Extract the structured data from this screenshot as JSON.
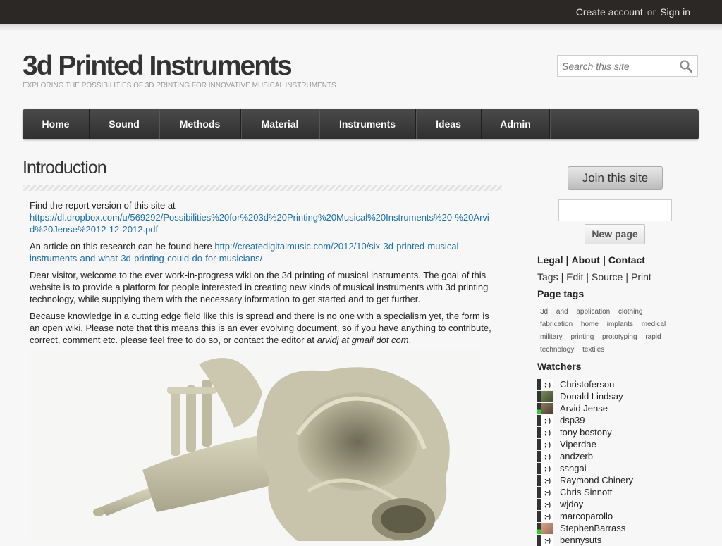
{
  "topbar": {
    "create_account": "Create account",
    "or": "or",
    "sign_in": "Sign in"
  },
  "header": {
    "title": "3d Printed Instruments",
    "subtitle": "Exploring the possibilities of 3D printing for innovative musical instruments"
  },
  "search": {
    "placeholder": "Search this site",
    "icon": "search-icon"
  },
  "nav": {
    "items": [
      "Home",
      "Sound",
      "Methods",
      "Material",
      "Instruments",
      "Ideas",
      "Admin"
    ]
  },
  "page": {
    "title": "Introduction",
    "p1_text": "Find the report version of this site at",
    "p1_link": "https://dl.dropbox.com/u/569292/Possibilities%20for%203d%20Printing%20Musical%20Instruments%20-%20Arvid%20Jense%2012-12-2012.pdf",
    "p2_text": "An article on this research can be found here",
    "p2_link": "http://createdigitalmusic.com/2012/10/six-3d-printed-musical-instruments-and-what-3d-printing-could-do-for-musicians/",
    "p3": "Dear visitor, welcome to the ever work-in-progress wiki on the 3d printing of musical instruments. The goal of this website is to provide a platform for people interested in creating new kinds of musical instruments with 3d printing technology, while supplying them with the necessary information to get started and to get further.",
    "p4_text": "Because knowledge in a cutting edge field like this is spread and there is no one with a specialism yet, the form is an open wiki. Please note that this means this is an ever evolving document, so if you have anything to contribute, correct, comment etc. please feel free to do so, or contact the editor at",
    "p4_email": "arvidj at gmail dot com",
    "p4_end": "."
  },
  "sidebar": {
    "join": "Join this site",
    "new_page": "New page",
    "links1": [
      "Legal",
      "About",
      "Contact"
    ],
    "links2": [
      "Tags",
      "Edit",
      "Source",
      "Print"
    ],
    "separator": "|",
    "page_tags_heading": "Page tags",
    "tags": [
      "3d",
      "and",
      "application",
      "clothing",
      "fabrication",
      "home",
      "implants",
      "medical",
      "military",
      "printing",
      "prototyping",
      "rapid",
      "technology",
      "textiles"
    ],
    "watchers_heading": "Watchers",
    "watchers": [
      {
        "name": "Christoferson",
        "avatar": ";-)"
      },
      {
        "name": "Donald Lindsay",
        "avatar": "photo"
      },
      {
        "name": "Arvid Jense",
        "avatar": "photo"
      },
      {
        "name": "dsp39",
        "avatar": ";-)"
      },
      {
        "name": "tony bostony",
        "avatar": ";-)"
      },
      {
        "name": "Viperdae",
        "avatar": ";-)"
      },
      {
        "name": "andzerb",
        "avatar": ";-)"
      },
      {
        "name": "ssngai",
        "avatar": ";-)"
      },
      {
        "name": "Raymond Chinery",
        "avatar": ";-)"
      },
      {
        "name": "Chris Sinnott",
        "avatar": ";-)"
      },
      {
        "name": "wjdoy",
        "avatar": ";-)"
      },
      {
        "name": "marcoparollo",
        "avatar": ";-)"
      },
      {
        "name": "StephenBarrass",
        "avatar": "photo"
      },
      {
        "name": "bennysuts",
        "avatar": ";-)"
      }
    ]
  }
}
